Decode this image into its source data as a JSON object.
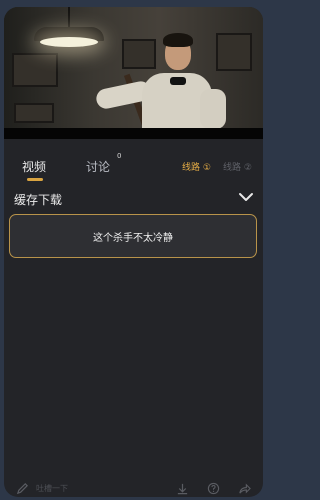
{
  "video": {
    "scene": "man-with-bowtie-under-lamp"
  },
  "tabs": [
    {
      "label": "视频",
      "active": true
    },
    {
      "label": "讨论",
      "active": false,
      "badge": "0"
    }
  ],
  "lines": {
    "active_label": "线路 ①",
    "dim_label": "线路 ②"
  },
  "cache": {
    "title": "缓存下载",
    "chevron_icon": "chevron-down-icon"
  },
  "episodes": [
    {
      "title": "这个杀手不太冷静",
      "selected": true
    }
  ],
  "bottom_bar": {
    "comment_placeholder": "吐槽一下",
    "icons": [
      "edit-icon",
      "download-icon",
      "help-icon",
      "share-icon"
    ]
  },
  "colors": {
    "accent": "#d9a441",
    "card_border": "#b8934a",
    "background": "#232428"
  }
}
